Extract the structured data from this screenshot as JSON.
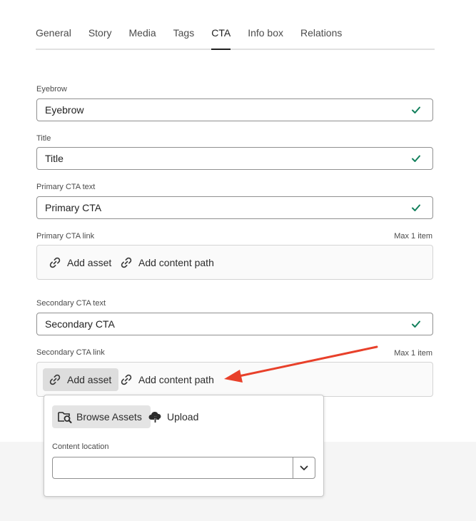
{
  "tabs": [
    {
      "label": "General"
    },
    {
      "label": "Story"
    },
    {
      "label": "Media"
    },
    {
      "label": "Tags"
    },
    {
      "label": "CTA"
    },
    {
      "label": "Info box"
    },
    {
      "label": "Relations"
    }
  ],
  "active_tab": "CTA",
  "form": {
    "eyebrow": {
      "label": "Eyebrow",
      "value": "Eyebrow"
    },
    "title": {
      "label": "Title",
      "value": "Title"
    },
    "primary_cta_text": {
      "label": "Primary CTA text",
      "value": "Primary CTA"
    },
    "primary_cta_link": {
      "label": "Primary CTA link",
      "limit": "Max 1 item",
      "add_asset": "Add asset",
      "add_content_path": "Add content path"
    },
    "secondary_cta_text": {
      "label": "Secondary CTA text",
      "value": "Secondary CTA"
    },
    "secondary_cta_link": {
      "label": "Secondary CTA link",
      "limit": "Max 1 item",
      "add_asset": "Add asset",
      "add_content_path": "Add content path"
    }
  },
  "popover": {
    "browse_assets": "Browse Assets",
    "upload": "Upload",
    "content_location_label": "Content location",
    "content_location_value": ""
  },
  "icons": {
    "valid": "checkmark-icon",
    "link": "link-icon",
    "browse": "folder-search-icon",
    "upload": "cloud-upload-icon",
    "dropdown": "chevron-down-icon"
  },
  "colors": {
    "valid_check": "#12805c",
    "annotation_arrow": "#e8402a",
    "active_tab_underline": "#1f1f1f"
  }
}
